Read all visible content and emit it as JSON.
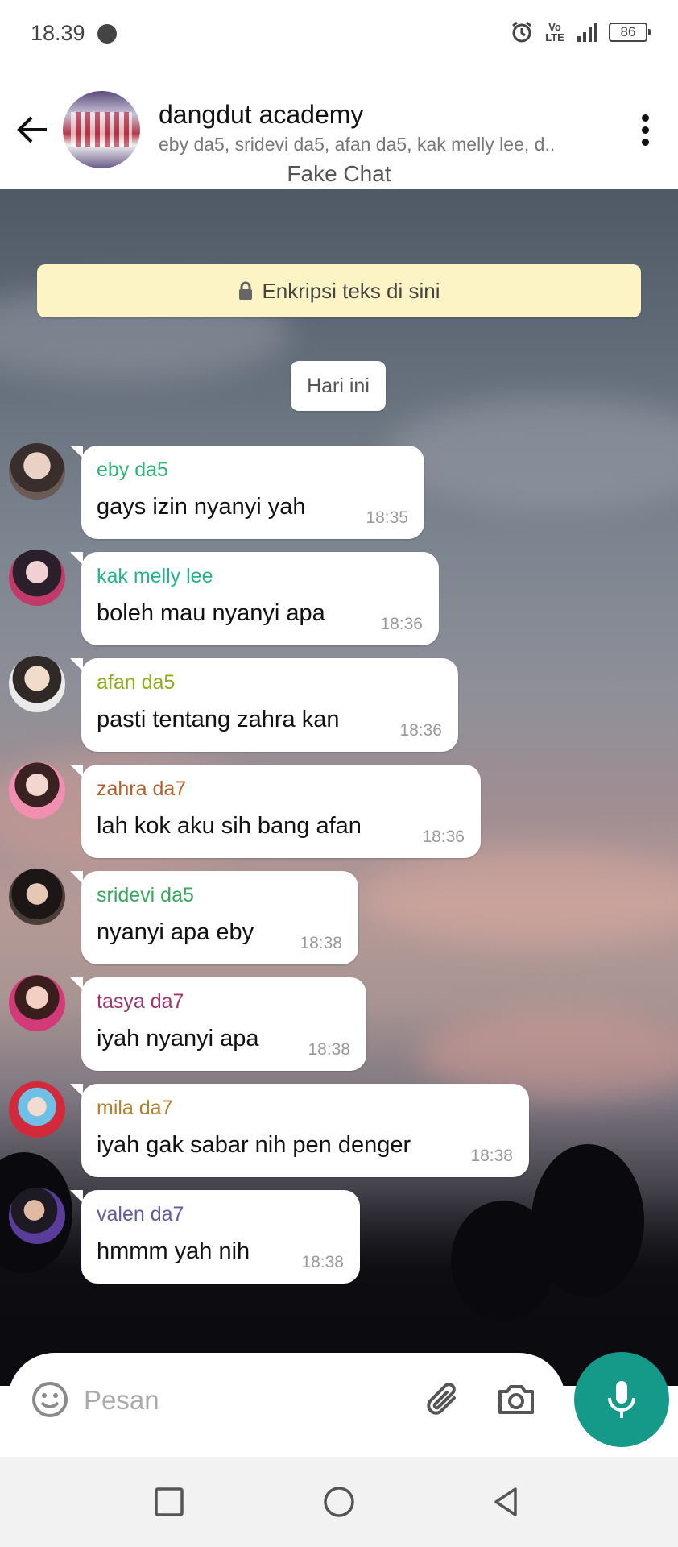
{
  "status_bar": {
    "time": "18.39",
    "network": "Vo LTE",
    "battery": "86"
  },
  "header": {
    "title": "dangdut academy",
    "members": "eby da5, sridevi da5, afan da5, kak melly lee, d..",
    "fake_label": "Fake Chat"
  },
  "banner": {
    "encryption": "Enkripsi teks di sini"
  },
  "date_chip": "Hari ini",
  "messages": [
    {
      "sender": "eby da5",
      "text": "gays izin nyanyi yah",
      "time": "18:35",
      "color": "#2bb673"
    },
    {
      "sender": "kak melly lee",
      "text": "boleh mau nyanyi apa",
      "time": "18:36",
      "color": "#26b38c"
    },
    {
      "sender": "afan da5",
      "text": "pasti tentang zahra kan",
      "time": "18:36",
      "color": "#8bad1c"
    },
    {
      "sender": "zahra da7",
      "text": "lah kok aku sih bang afan",
      "time": "18:36",
      "color": "#b5612a"
    },
    {
      "sender": "sridevi da5",
      "text": "nyanyi apa eby",
      "time": "18:38",
      "color": "#3aa661"
    },
    {
      "sender": "tasya da7",
      "text": "iyah nyanyi apa",
      "time": "18:38",
      "color": "#a1346a"
    },
    {
      "sender": "mila da7",
      "text": "iyah gak sabar nih pen denger",
      "time": "18:38",
      "color": "#b3812b"
    },
    {
      "sender": "valen da7",
      "text": "hmmm yah nih",
      "time": "18:38",
      "color": "#5c5f9c"
    }
  ],
  "input": {
    "placeholder": "Pesan"
  },
  "icons": {
    "back": "arrow-left-icon",
    "more": "more-vert-icon",
    "lock": "lock-icon",
    "emoji": "emoji-icon",
    "attach": "paperclip-icon",
    "camera": "camera-icon",
    "mic": "microphone-icon",
    "nav_recent": "square-icon",
    "nav_home": "circle-icon",
    "nav_back": "triangle-back-icon"
  },
  "colors": {
    "accent": "#159a8a",
    "banner": "#fdf4c5"
  }
}
